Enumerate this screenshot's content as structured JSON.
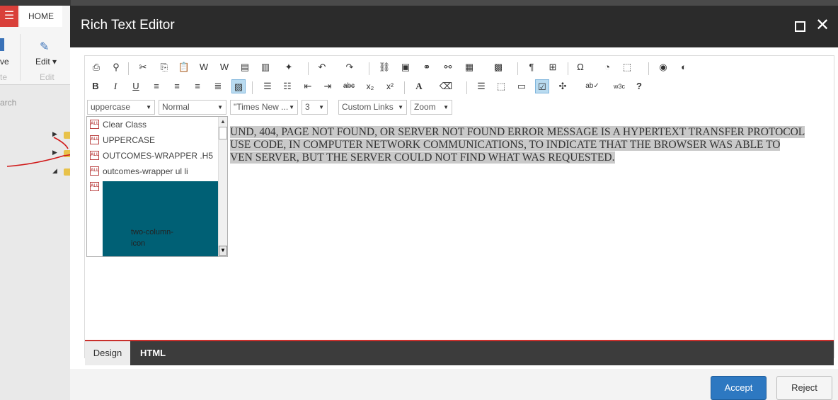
{
  "background": {
    "tab_menu": "☰",
    "tab_home": "HOME",
    "save_label": "ve",
    "save_group": "te",
    "edit_label": "Edit ▾",
    "edit_group": "Edit",
    "search_placeholder": "arch"
  },
  "dialog": {
    "title": "Rich Text Editor",
    "maximize": "□",
    "close": "✕"
  },
  "toolbar": {
    "styles_value": "uppercase",
    "paragraph_value": "Normal",
    "font_value": "\"Times New ...",
    "size_value": "3",
    "custom_links_value": "Custom Links",
    "zoom_value": "Zoom"
  },
  "class_dropdown": {
    "items": [
      {
        "label": "Clear Class"
      },
      {
        "label": "UPPERCASE"
      },
      {
        "label": "OUTCOMES-WRAPPER .H5"
      },
      {
        "label": "outcomes-wrapper ul li"
      }
    ],
    "block_label": "two-column-icon",
    "badge": "ALL"
  },
  "content": {
    "line1": "UND, 404, PAGE NOT FOUND, OR SERVER NOT FOUND ERROR MESSAGE IS A HYPERTEXT TRANSFER PROTOCOL",
    "line2": "USE CODE, IN COMPUTER NETWORK COMMUNICATIONS, TO INDICATE THAT THE BROWSER WAS ABLE TO",
    "line3": "VEN SERVER, BUT THE SERVER COULD NOT FIND WHAT WAS REQUESTED."
  },
  "modes": {
    "design": "Design",
    "html": "HTML"
  },
  "footer": {
    "accept": "Accept",
    "reject": "Reject"
  },
  "colors": {
    "accept": "#2d78c1",
    "title_bar": "#2b2b2b",
    "selection": "#c9c9c9",
    "class_block": "#006075"
  }
}
